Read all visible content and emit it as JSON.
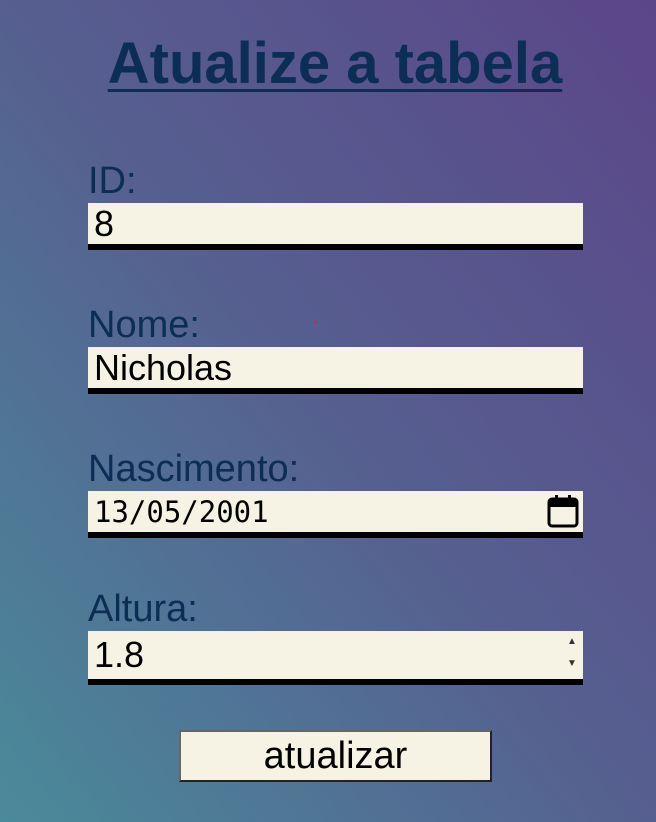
{
  "page": {
    "title": "Atualize a tabela"
  },
  "form": {
    "id": {
      "label": "ID:",
      "value": "8"
    },
    "nome": {
      "label": "Nome:",
      "value": "Nicholas"
    },
    "nascimento": {
      "label": "Nascimento:",
      "value": "13/05/2001",
      "icon": "calendar-icon"
    },
    "altura": {
      "label": "Altura:",
      "value": "1.8",
      "spinner_up": "▲",
      "spinner_down": "▼"
    },
    "submit_label": "atualizar"
  },
  "colors": {
    "text": "#0c2d55",
    "field_bg": "#f6f2e4",
    "gradient": [
      "#4a8a9a",
      "#565f90",
      "#5b4689"
    ]
  }
}
